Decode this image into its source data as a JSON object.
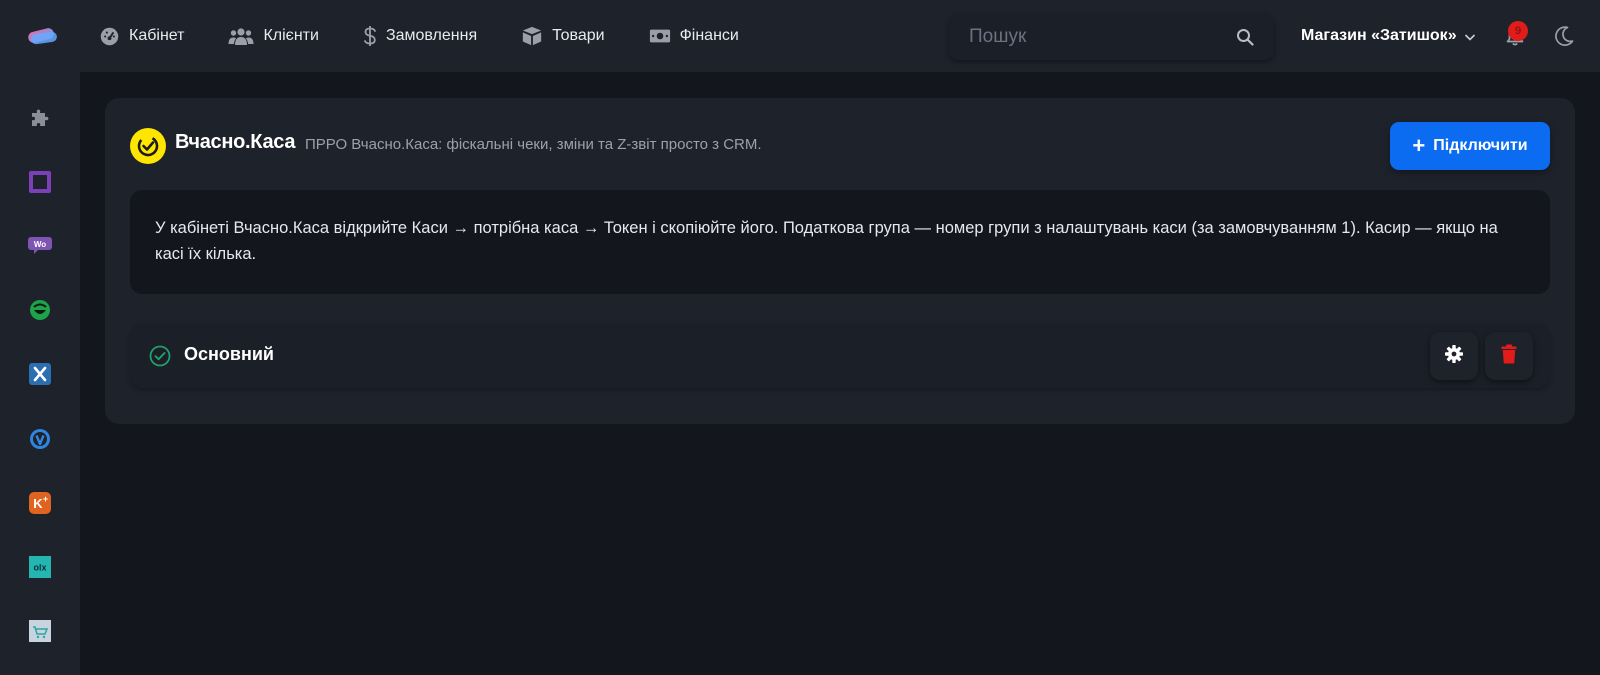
{
  "topbar": {
    "nav": [
      {
        "label": "Кабінет",
        "icon": "gauge-icon"
      },
      {
        "label": "Клієнти",
        "icon": "users-icon"
      },
      {
        "label": "Замовлення",
        "icon": "dollar-icon"
      },
      {
        "label": "Товари",
        "icon": "box-icon"
      },
      {
        "label": "Фінанси",
        "icon": "money-icon"
      }
    ],
    "search_placeholder": "Пошук",
    "store_name": "Магазин «Затишок»",
    "notifications_count": "9"
  },
  "sidebar": {
    "items": [
      {
        "icon": "puzzle-icon",
        "color": "#8a8f99"
      },
      {
        "icon": "purple-square-icon",
        "color": "#7b3fb8"
      },
      {
        "icon": "woocommerce-icon",
        "color": "#7f54b3"
      },
      {
        "icon": "green-smile-icon",
        "color": "#1fa34a"
      },
      {
        "icon": "x-icon",
        "color": "#2b6fb0"
      },
      {
        "icon": "shield-icon",
        "color": "#2e86de"
      },
      {
        "icon": "k-plus-icon",
        "color": "#e0641f"
      },
      {
        "icon": "olx-icon",
        "color": "#23b5b0"
      },
      {
        "icon": "cart-icon",
        "color": "#c9d3de"
      }
    ]
  },
  "integration": {
    "title": "Вчасно.Каса",
    "subtitle": "ПРРО Вчасно.Каса: фіскальні чеки, зміни та Z-звіт просто з CRM.",
    "connect_label": "Підключити",
    "info": "У кабінеті Вчасно.Каса відкрийте Каси → потрібна каса → Токен і скопіюйте його. Податкова група — номер групи з налаштувань каси (за замовчуванням 1). Касир — якщо на касі їх кілька.",
    "accounts": [
      {
        "name": "Основний",
        "status": "active"
      }
    ],
    "colors": {
      "brand_yellow": "#ffe600",
      "accent_blue": "#0b6cf2",
      "success_green": "#22a06b",
      "danger_red": "#e21b1b"
    }
  }
}
